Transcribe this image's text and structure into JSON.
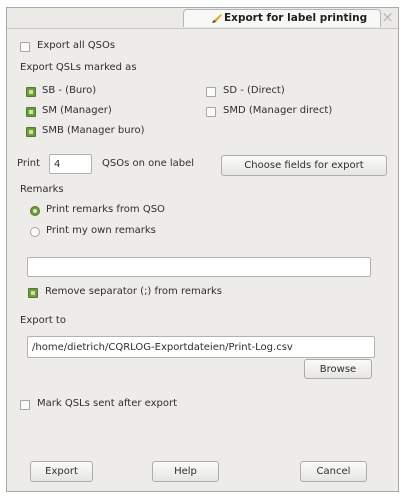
{
  "window": {
    "title": "Export for label printing",
    "close_icon": "×"
  },
  "export_all": {
    "label": "Export all QSOs",
    "checked": false
  },
  "marked_as": {
    "heading": "Export QSLs marked as",
    "options": [
      {
        "label": "SB - (Buro)",
        "checked": true
      },
      {
        "label": "SD - (Direct)",
        "checked": false
      },
      {
        "label": "SM (Manager)",
        "checked": true
      },
      {
        "label": "SMD (Manager direct)",
        "checked": false
      },
      {
        "label": "SMB (Manager buro)",
        "checked": true
      }
    ]
  },
  "print": {
    "label": "Print",
    "value": "4",
    "suffix": "QSOs on one label",
    "choose_fields_button": "Choose fields for export"
  },
  "remarks": {
    "heading": "Remarks",
    "from_qso": "Print remarks from QSO",
    "own": "Print my own remarks",
    "selected": "from_qso",
    "own_value": "",
    "remove_separator": {
      "label": "Remove separator (;) from remarks",
      "checked": true
    }
  },
  "export_to": {
    "heading": "Export to",
    "path": "/home/dietrich/CQRLOG-Exportdateien/Print-Log.csv",
    "browse_button": "Browse"
  },
  "mark_sent": {
    "label": "Mark QSLs sent after export",
    "checked": false
  },
  "footer": {
    "export_button": "Export",
    "help_button": "Help",
    "cancel_button": "Cancel"
  },
  "colors": {
    "accent": "#6f9b3c",
    "window_bg": "#edece9"
  }
}
